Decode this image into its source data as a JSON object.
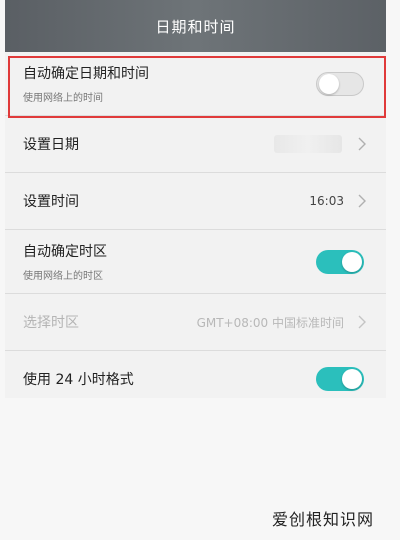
{
  "header": {
    "title": "日期和时间"
  },
  "rows": {
    "auto_datetime": {
      "label": "自动确定日期和时间",
      "sub": "使用网络上的时间",
      "enabled": false
    },
    "set_date": {
      "label": "设置日期"
    },
    "set_time": {
      "label": "设置时间",
      "value": "16:03"
    },
    "auto_timezone": {
      "label": "自动确定时区",
      "sub": "使用网络上的时区",
      "enabled": true
    },
    "select_timezone": {
      "label": "选择时区",
      "value": "GMT+08:00 中国标准时间"
    },
    "use_24h": {
      "label": "使用 24 小时格式",
      "enabled": true
    }
  },
  "colors": {
    "toggle_on": "#2bbfbc",
    "highlight": "#e03a3a",
    "titlebar": "#62676c"
  },
  "icons": {
    "chevron": "chevron-right-icon"
  },
  "watermark": "爱创根知识网"
}
